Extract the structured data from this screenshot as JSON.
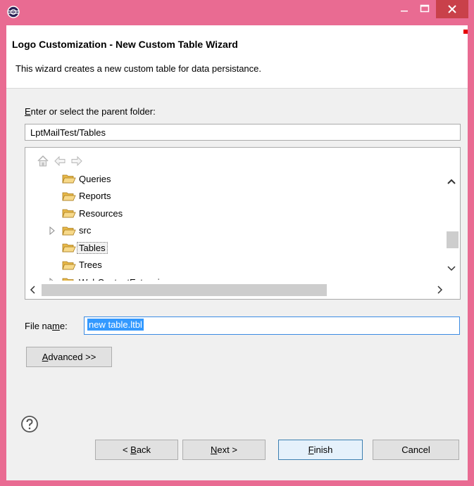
{
  "window": {
    "title_icon": "eclipse-app-icon",
    "controls": {
      "minimize": "minimize-icon",
      "maximize": "maximize-icon",
      "close": "close-icon"
    }
  },
  "banner": {
    "title": "Logo Customization - New Custom Table Wizard",
    "description": "This wizard creates a new custom table for data persistance."
  },
  "parent": {
    "label_accesskey": "E",
    "label_rest": "nter or select the parent folder:",
    "value": "LptMailTest/Tables"
  },
  "tree": {
    "toolbar": [
      "home-icon",
      "back-arrow-icon",
      "forward-arrow-icon"
    ],
    "items": [
      {
        "label": "Queries",
        "expandable": false,
        "selected": false
      },
      {
        "label": "Reports",
        "expandable": false,
        "selected": false
      },
      {
        "label": "Resources",
        "expandable": false,
        "selected": false
      },
      {
        "label": "src",
        "expandable": true,
        "selected": false
      },
      {
        "label": "Tables",
        "expandable": false,
        "selected": true
      },
      {
        "label": "Trees",
        "expandable": false,
        "selected": false
      },
      {
        "label": "WebContentExtensions",
        "expandable": true,
        "selected": false
      }
    ]
  },
  "file_name": {
    "label_pre": "File na",
    "label_accesskey": "m",
    "label_post": "e:",
    "value": "new table.ltbl"
  },
  "buttons": {
    "advanced_accesskey": "A",
    "advanced_rest": "dvanced >>",
    "back_pre": "< ",
    "back_accesskey": "B",
    "back_rest": "ack",
    "next_accesskey": "N",
    "next_rest": "ext >",
    "finish_accesskey": "F",
    "finish_rest": "inish",
    "cancel": "Cancel"
  },
  "colors": {
    "window_frame": "#e96b92",
    "close_button": "#c9414a",
    "dialog_bg": "#f0f0f0",
    "selection": "#3399ff",
    "folder": "#e8b94a"
  }
}
